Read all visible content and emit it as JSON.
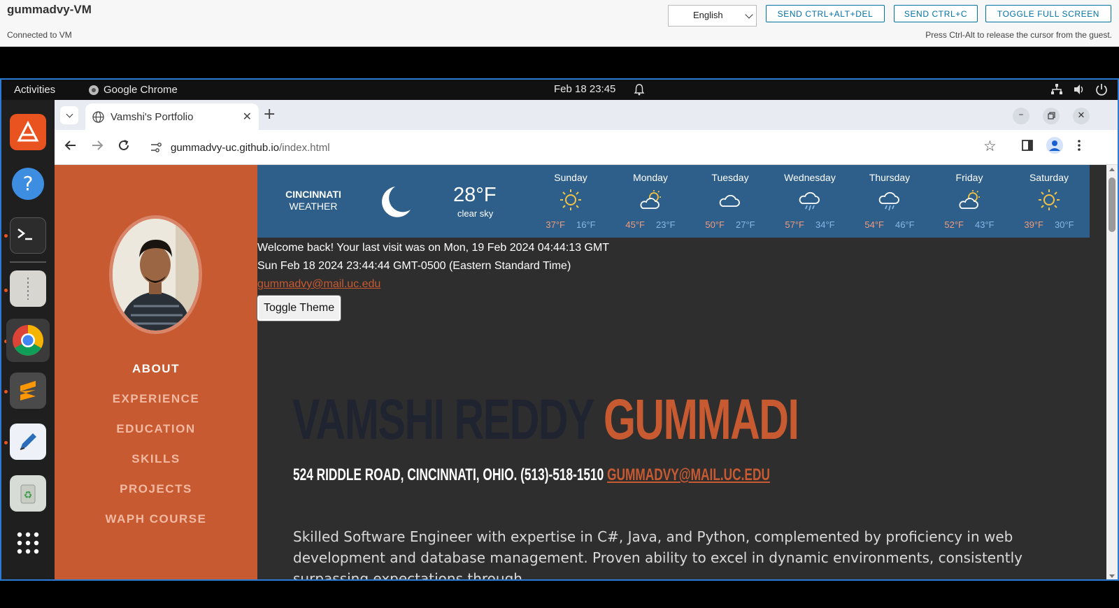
{
  "vm": {
    "title": "gummadvy-VM",
    "status": "Connected to VM",
    "hint": "Press Ctrl-Alt to release the cursor from the guest.",
    "language": "English",
    "buttons": [
      "SEND CTRL+ALT+DEL",
      "SEND CTRL+C",
      "TOGGLE FULL SCREEN"
    ]
  },
  "topbar": {
    "activities": "Activities",
    "app": "Google Chrome",
    "clock": "Feb 18  23:45"
  },
  "browser": {
    "tab_title": "Vamshi's Portfolio",
    "url_host": "gummadvy-uc.github.io",
    "url_path": "/index.html"
  },
  "sidebar": {
    "nav": [
      "ABOUT",
      "EXPERIENCE",
      "EDUCATION",
      "SKILLS",
      "PROJECTS",
      "WAPH COURSE"
    ],
    "active": "ABOUT"
  },
  "weather": {
    "city": "CINCINNATI",
    "label": "WEATHER",
    "temp": "28°F",
    "desc": "clear sky",
    "days": [
      {
        "name": "Sunday",
        "icon": "sun-icon",
        "hi": "37°F",
        "lo": "16°F"
      },
      {
        "name": "Monday",
        "icon": "partly-cloudy-icon",
        "hi": "45°F",
        "lo": "23°F"
      },
      {
        "name": "Tuesday",
        "icon": "cloud-icon",
        "hi": "50°F",
        "lo": "27°F"
      },
      {
        "name": "Wednesday",
        "icon": "rain-icon",
        "hi": "57°F",
        "lo": "34°F"
      },
      {
        "name": "Thursday",
        "icon": "rain-icon",
        "hi": "54°F",
        "lo": "46°F"
      },
      {
        "name": "Friday",
        "icon": "partly-cloudy-icon",
        "hi": "52°F",
        "lo": "43°F"
      },
      {
        "name": "Saturday",
        "icon": "sun-icon",
        "hi": "39°F",
        "lo": "30°F"
      }
    ]
  },
  "content": {
    "welcome": "Welcome back! Your last visit was on Mon, 19 Feb 2024 04:44:13 GMT",
    "datetime": "Sun Feb 18 2024 23:44:44 GMT-0500 (Eastern Standard Time)",
    "email": "gummadvy@mail.uc.edu",
    "toggle": "Toggle Theme",
    "first_name": "VAMSHI REDDY",
    "last_name": "GUMMADI",
    "address": "524 RIDDLE ROAD, CINCINNATI, OHIO. (513)-518-1510",
    "address_email": "GUMMADVY@MAIL.UC.EDU",
    "bio": "Skilled Software Engineer with expertise in C#, Java, and Python, complemented by proficiency in web development and database management. Proven ability to excel in dynamic environments, consistently surpassing expectations through"
  },
  "colors": {
    "accent": "#c75a31",
    "weather_bg": "#2d5f8a",
    "page_bg": "#2e2e2e"
  }
}
